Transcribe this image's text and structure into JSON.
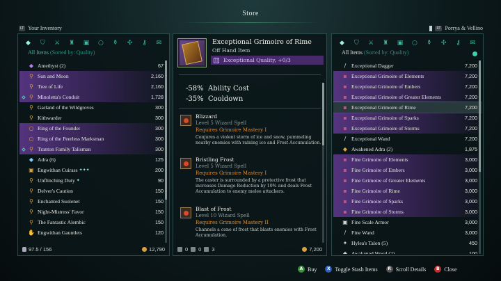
{
  "header": {
    "title": "Store",
    "left_hint_key": "LT",
    "left_hint": "Your Inventory",
    "right_hint_key": "RT",
    "right_hint": "Porrya & Vellino"
  },
  "left": {
    "sort_label": "All Items",
    "sort_sub": "(Sorted by: Quality)",
    "tabs": [
      "gem-icon",
      "shield-icon",
      "sword-icon",
      "helmet-icon",
      "armor-icon",
      "ring-icon",
      "potion-icon",
      "misc-icon",
      "key-icon",
      "scroll-icon"
    ],
    "rows": [
      {
        "label": "Amethyst (2)",
        "value": "67",
        "style": "",
        "icon": "◆",
        "color": "#b583e6"
      },
      {
        "label": "Sun and Moon",
        "value": "2,160",
        "style": "pur",
        "icon": "⚲",
        "color": "#d9a23a"
      },
      {
        "label": "Tree of Life",
        "value": "2,160",
        "style": "pur",
        "icon": "⚲",
        "color": "#d9a23a"
      },
      {
        "label": "Minoletta's Conduit",
        "value": "1,728",
        "style": "pur",
        "icon": "⚲",
        "color": "#d9a23a",
        "mark": true
      },
      {
        "label": "Garland of the Wildgroves",
        "value": "300",
        "style": "",
        "icon": "⚲",
        "color": "#d9a23a"
      },
      {
        "label": "Kithwarder",
        "value": "300",
        "style": "",
        "icon": "⚲",
        "color": "#d9a23a"
      },
      {
        "label": "Ring of the Founder",
        "value": "300",
        "style": "pur",
        "icon": "○",
        "color": "#d9a23a"
      },
      {
        "label": "Ring of the Peerless Marksman",
        "value": "300",
        "style": "pur",
        "icon": "○",
        "color": "#d9a23a"
      },
      {
        "label": "Tranton Family Talisman",
        "value": "300",
        "style": "pur",
        "icon": "⚲",
        "color": "#d9a23a",
        "mark": true
      },
      {
        "label": "Adra (6)",
        "value": "125",
        "style": "",
        "icon": "◆",
        "color": "#7fd0ff"
      },
      {
        "label": "Engwithan Cuirass",
        "value": "200",
        "style": "",
        "icon": "▣",
        "color": "#d9a23a",
        "stars": "✦✦✦"
      },
      {
        "label": "Unflinching Duty",
        "value": "90",
        "style": "",
        "icon": "⚲",
        "color": "#d9a23a",
        "stars": "✦"
      },
      {
        "label": "Delver's Caution",
        "value": "150",
        "style": "",
        "icon": "⚲",
        "color": "#d9a23a"
      },
      {
        "label": "Enchanted Suolenet",
        "value": "150",
        "style": "",
        "icon": "⚲",
        "color": "#d9a23a"
      },
      {
        "label": "Night-Mistress' Favor",
        "value": "150",
        "style": "",
        "icon": "⚲",
        "color": "#d9a23a"
      },
      {
        "label": "The Fantastic Alembic",
        "value": "150",
        "style": "",
        "icon": "⚲",
        "color": "#d9a23a"
      },
      {
        "label": "Engwithan Gauntlets",
        "value": "120",
        "style": "",
        "icon": "✋",
        "color": "#d9a23a"
      }
    ],
    "weight": "97.5 / 156",
    "gold": "12,790"
  },
  "mid": {
    "name": "Exceptional Grimoire of Rime",
    "type": "Off Hand Item",
    "quality": "Exceptional Quality, +0/3",
    "stats": [
      {
        "num": "-58%",
        "label": "Ability Cost"
      },
      {
        "num": "-35%",
        "label": "Cooldown"
      }
    ],
    "spells": [
      {
        "name": "Blizzard",
        "level": "Level 5 Wizard Spell",
        "req": "Requires Grimoire Mastery I",
        "desc": "Conjures a violent storm of ice and snow, pummeling nearby enemies with raining ice and Frost Accumulation."
      },
      {
        "name": "Bristling Frost",
        "level": "Level 5 Wizard Spell",
        "req": "Requires Grimoire Mastery I",
        "desc": "The caster is surrounded by a protective frost that increases Damage Reduction by 10% and deals Frost Accumulation to enemy melee attackers."
      },
      {
        "name": "Blast of Frost",
        "level": "Level 10 Wizard Spell",
        "req": "Requires Grimoire Mastery II",
        "desc": "Channels a cone of frost that blasts enemies with Frost Accumulation."
      }
    ],
    "foot": {
      "a": "0",
      "b": "0",
      "c": "3",
      "price": "7,200"
    }
  },
  "right": {
    "sort_label": "All Items",
    "sort_sub": "(Sorted by: Quality)",
    "tabs": [
      "gem-icon",
      "shield-icon",
      "sword-icon",
      "helmet-icon",
      "armor-icon",
      "ring-icon",
      "potion-icon",
      "misc-icon",
      "key-icon",
      "scroll-icon"
    ],
    "rows": [
      {
        "label": "Exceptional Dagger",
        "value": "7,200",
        "style": "",
        "icon": "/",
        "color": "#cfd6d2"
      },
      {
        "label": "Exceptional Grimoire of Elements",
        "value": "7,200",
        "style": "pur",
        "icon": "▪",
        "color": "#b58"
      },
      {
        "label": "Exceptional Grimoire of Embers",
        "value": "7,200",
        "style": "pur",
        "icon": "▪",
        "color": "#b58"
      },
      {
        "label": "Exceptional Grimoire of Greater Elements",
        "value": "7,200",
        "style": "pur",
        "icon": "▪",
        "color": "#b58"
      },
      {
        "label": "Exceptional Grimoire of Rime",
        "value": "7,200",
        "style": "sel",
        "icon": "▪",
        "color": "#b58"
      },
      {
        "label": "Exceptional Grimoire of Sparks",
        "value": "7,200",
        "style": "pur",
        "icon": "▪",
        "color": "#b58"
      },
      {
        "label": "Exceptional Grimoire of Storms",
        "value": "7,200",
        "style": "pur",
        "icon": "▪",
        "color": "#b58"
      },
      {
        "label": "Exceptional Wand",
        "value": "7,200",
        "style": "",
        "icon": "/",
        "color": "#cfd6d2"
      },
      {
        "label": "Awakened Adra (2)",
        "value": "1,875",
        "style": "",
        "icon": "◆",
        "color": "#d9a23a"
      },
      {
        "label": "Fine Grimoire of Elements",
        "value": "3,000",
        "style": "pur",
        "icon": "▪",
        "color": "#b58"
      },
      {
        "label": "Fine Grimoire of Embers",
        "value": "3,000",
        "style": "pur",
        "icon": "▪",
        "color": "#b58"
      },
      {
        "label": "Fine Grimoire of Greater Elements",
        "value": "3,000",
        "style": "pur",
        "icon": "▪",
        "color": "#b58"
      },
      {
        "label": "Fine Grimoire of Rime",
        "value": "3,000",
        "style": "pur",
        "icon": "▪",
        "color": "#b58"
      },
      {
        "label": "Fine Grimoire of Sparks",
        "value": "3,000",
        "style": "pur",
        "icon": "▪",
        "color": "#b58"
      },
      {
        "label": "Fine Grimoire of Storms",
        "value": "3,000",
        "style": "pur",
        "icon": "▪",
        "color": "#b58"
      },
      {
        "label": "Fine Scale Armor",
        "value": "3,000",
        "style": "",
        "icon": "▣",
        "color": "#cfd6d2"
      },
      {
        "label": "Fine Wand",
        "value": "3,000",
        "style": "",
        "icon": "/",
        "color": "#cfd6d2"
      },
      {
        "label": "Hylea's Talon (5)",
        "value": "450",
        "style": "",
        "icon": "✦",
        "color": "#cfd6d2"
      },
      {
        "label": "Awakened Wood (2)",
        "value": "100",
        "style": "",
        "icon": "◆",
        "color": "#cfd6d2"
      }
    ]
  },
  "buttons": [
    {
      "key": "A",
      "cls": "a",
      "label": "Buy"
    },
    {
      "key": "X",
      "cls": "x",
      "label": "Toggle Stash Items"
    },
    {
      "key": "R",
      "cls": "r",
      "label": "Scroll Details"
    },
    {
      "key": "B",
      "cls": "b",
      "label": "Close"
    }
  ]
}
